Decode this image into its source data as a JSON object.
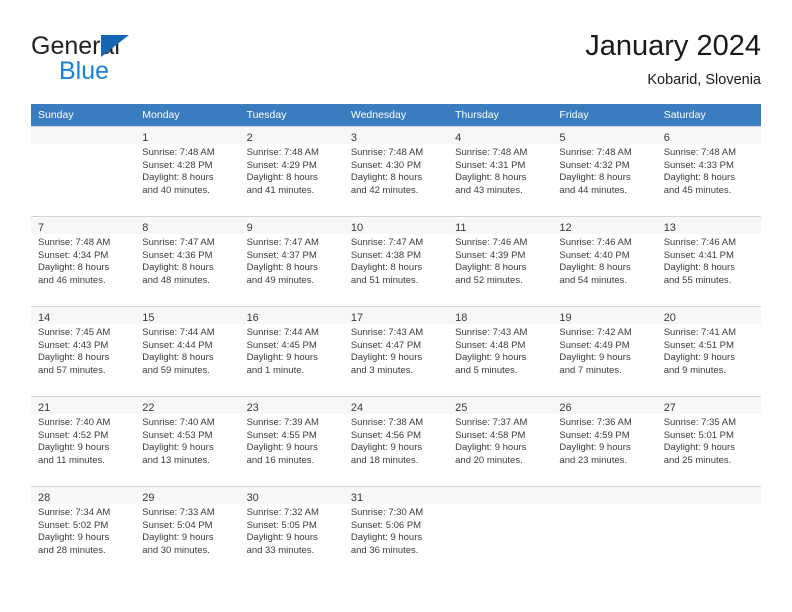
{
  "brand": {
    "name_part1": "General",
    "name_part2": "Blue",
    "triangle_color": "#1565b0",
    "blue_color": "#1c7fd4"
  },
  "header": {
    "title": "January 2024",
    "location": "Kobarid, Slovenia"
  },
  "theme": {
    "header_row_bg": "#3a7dbf",
    "header_row_text": "#ffffff",
    "daynum_bg": "#f0f0f0",
    "cell_border": "#d4d4d4",
    "text_color": "#3b3b3b"
  },
  "weekdays": [
    "Sunday",
    "Monday",
    "Tuesday",
    "Wednesday",
    "Thursday",
    "Friday",
    "Saturday"
  ],
  "weeks": [
    [
      {
        "day": "",
        "sunrise": "",
        "sunset": "",
        "daylight1": "",
        "daylight2": ""
      },
      {
        "day": "1",
        "sunrise": "Sunrise: 7:48 AM",
        "sunset": "Sunset: 4:28 PM",
        "daylight1": "Daylight: 8 hours",
        "daylight2": "and 40 minutes."
      },
      {
        "day": "2",
        "sunrise": "Sunrise: 7:48 AM",
        "sunset": "Sunset: 4:29 PM",
        "daylight1": "Daylight: 8 hours",
        "daylight2": "and 41 minutes."
      },
      {
        "day": "3",
        "sunrise": "Sunrise: 7:48 AM",
        "sunset": "Sunset: 4:30 PM",
        "daylight1": "Daylight: 8 hours",
        "daylight2": "and 42 minutes."
      },
      {
        "day": "4",
        "sunrise": "Sunrise: 7:48 AM",
        "sunset": "Sunset: 4:31 PM",
        "daylight1": "Daylight: 8 hours",
        "daylight2": "and 43 minutes."
      },
      {
        "day": "5",
        "sunrise": "Sunrise: 7:48 AM",
        "sunset": "Sunset: 4:32 PM",
        "daylight1": "Daylight: 8 hours",
        "daylight2": "and 44 minutes."
      },
      {
        "day": "6",
        "sunrise": "Sunrise: 7:48 AM",
        "sunset": "Sunset: 4:33 PM",
        "daylight1": "Daylight: 8 hours",
        "daylight2": "and 45 minutes."
      }
    ],
    [
      {
        "day": "7",
        "sunrise": "Sunrise: 7:48 AM",
        "sunset": "Sunset: 4:34 PM",
        "daylight1": "Daylight: 8 hours",
        "daylight2": "and 46 minutes."
      },
      {
        "day": "8",
        "sunrise": "Sunrise: 7:47 AM",
        "sunset": "Sunset: 4:36 PM",
        "daylight1": "Daylight: 8 hours",
        "daylight2": "and 48 minutes."
      },
      {
        "day": "9",
        "sunrise": "Sunrise: 7:47 AM",
        "sunset": "Sunset: 4:37 PM",
        "daylight1": "Daylight: 8 hours",
        "daylight2": "and 49 minutes."
      },
      {
        "day": "10",
        "sunrise": "Sunrise: 7:47 AM",
        "sunset": "Sunset: 4:38 PM",
        "daylight1": "Daylight: 8 hours",
        "daylight2": "and 51 minutes."
      },
      {
        "day": "11",
        "sunrise": "Sunrise: 7:46 AM",
        "sunset": "Sunset: 4:39 PM",
        "daylight1": "Daylight: 8 hours",
        "daylight2": "and 52 minutes."
      },
      {
        "day": "12",
        "sunrise": "Sunrise: 7:46 AM",
        "sunset": "Sunset: 4:40 PM",
        "daylight1": "Daylight: 8 hours",
        "daylight2": "and 54 minutes."
      },
      {
        "day": "13",
        "sunrise": "Sunrise: 7:46 AM",
        "sunset": "Sunset: 4:41 PM",
        "daylight1": "Daylight: 8 hours",
        "daylight2": "and 55 minutes."
      }
    ],
    [
      {
        "day": "14",
        "sunrise": "Sunrise: 7:45 AM",
        "sunset": "Sunset: 4:43 PM",
        "daylight1": "Daylight: 8 hours",
        "daylight2": "and 57 minutes."
      },
      {
        "day": "15",
        "sunrise": "Sunrise: 7:44 AM",
        "sunset": "Sunset: 4:44 PM",
        "daylight1": "Daylight: 8 hours",
        "daylight2": "and 59 minutes."
      },
      {
        "day": "16",
        "sunrise": "Sunrise: 7:44 AM",
        "sunset": "Sunset: 4:45 PM",
        "daylight1": "Daylight: 9 hours",
        "daylight2": "and 1 minute."
      },
      {
        "day": "17",
        "sunrise": "Sunrise: 7:43 AM",
        "sunset": "Sunset: 4:47 PM",
        "daylight1": "Daylight: 9 hours",
        "daylight2": "and 3 minutes."
      },
      {
        "day": "18",
        "sunrise": "Sunrise: 7:43 AM",
        "sunset": "Sunset: 4:48 PM",
        "daylight1": "Daylight: 9 hours",
        "daylight2": "and 5 minutes."
      },
      {
        "day": "19",
        "sunrise": "Sunrise: 7:42 AM",
        "sunset": "Sunset: 4:49 PM",
        "daylight1": "Daylight: 9 hours",
        "daylight2": "and 7 minutes."
      },
      {
        "day": "20",
        "sunrise": "Sunrise: 7:41 AM",
        "sunset": "Sunset: 4:51 PM",
        "daylight1": "Daylight: 9 hours",
        "daylight2": "and 9 minutes."
      }
    ],
    [
      {
        "day": "21",
        "sunrise": "Sunrise: 7:40 AM",
        "sunset": "Sunset: 4:52 PM",
        "daylight1": "Daylight: 9 hours",
        "daylight2": "and 11 minutes."
      },
      {
        "day": "22",
        "sunrise": "Sunrise: 7:40 AM",
        "sunset": "Sunset: 4:53 PM",
        "daylight1": "Daylight: 9 hours",
        "daylight2": "and 13 minutes."
      },
      {
        "day": "23",
        "sunrise": "Sunrise: 7:39 AM",
        "sunset": "Sunset: 4:55 PM",
        "daylight1": "Daylight: 9 hours",
        "daylight2": "and 16 minutes."
      },
      {
        "day": "24",
        "sunrise": "Sunrise: 7:38 AM",
        "sunset": "Sunset: 4:56 PM",
        "daylight1": "Daylight: 9 hours",
        "daylight2": "and 18 minutes."
      },
      {
        "day": "25",
        "sunrise": "Sunrise: 7:37 AM",
        "sunset": "Sunset: 4:58 PM",
        "daylight1": "Daylight: 9 hours",
        "daylight2": "and 20 minutes."
      },
      {
        "day": "26",
        "sunrise": "Sunrise: 7:36 AM",
        "sunset": "Sunset: 4:59 PM",
        "daylight1": "Daylight: 9 hours",
        "daylight2": "and 23 minutes."
      },
      {
        "day": "27",
        "sunrise": "Sunrise: 7:35 AM",
        "sunset": "Sunset: 5:01 PM",
        "daylight1": "Daylight: 9 hours",
        "daylight2": "and 25 minutes."
      }
    ],
    [
      {
        "day": "28",
        "sunrise": "Sunrise: 7:34 AM",
        "sunset": "Sunset: 5:02 PM",
        "daylight1": "Daylight: 9 hours",
        "daylight2": "and 28 minutes."
      },
      {
        "day": "29",
        "sunrise": "Sunrise: 7:33 AM",
        "sunset": "Sunset: 5:04 PM",
        "daylight1": "Daylight: 9 hours",
        "daylight2": "and 30 minutes."
      },
      {
        "day": "30",
        "sunrise": "Sunrise: 7:32 AM",
        "sunset": "Sunset: 5:05 PM",
        "daylight1": "Daylight: 9 hours",
        "daylight2": "and 33 minutes."
      },
      {
        "day": "31",
        "sunrise": "Sunrise: 7:30 AM",
        "sunset": "Sunset: 5:06 PM",
        "daylight1": "Daylight: 9 hours",
        "daylight2": "and 36 minutes."
      },
      {
        "day": "",
        "sunrise": "",
        "sunset": "",
        "daylight1": "",
        "daylight2": ""
      },
      {
        "day": "",
        "sunrise": "",
        "sunset": "",
        "daylight1": "",
        "daylight2": ""
      },
      {
        "day": "",
        "sunrise": "",
        "sunset": "",
        "daylight1": "",
        "daylight2": ""
      }
    ]
  ]
}
